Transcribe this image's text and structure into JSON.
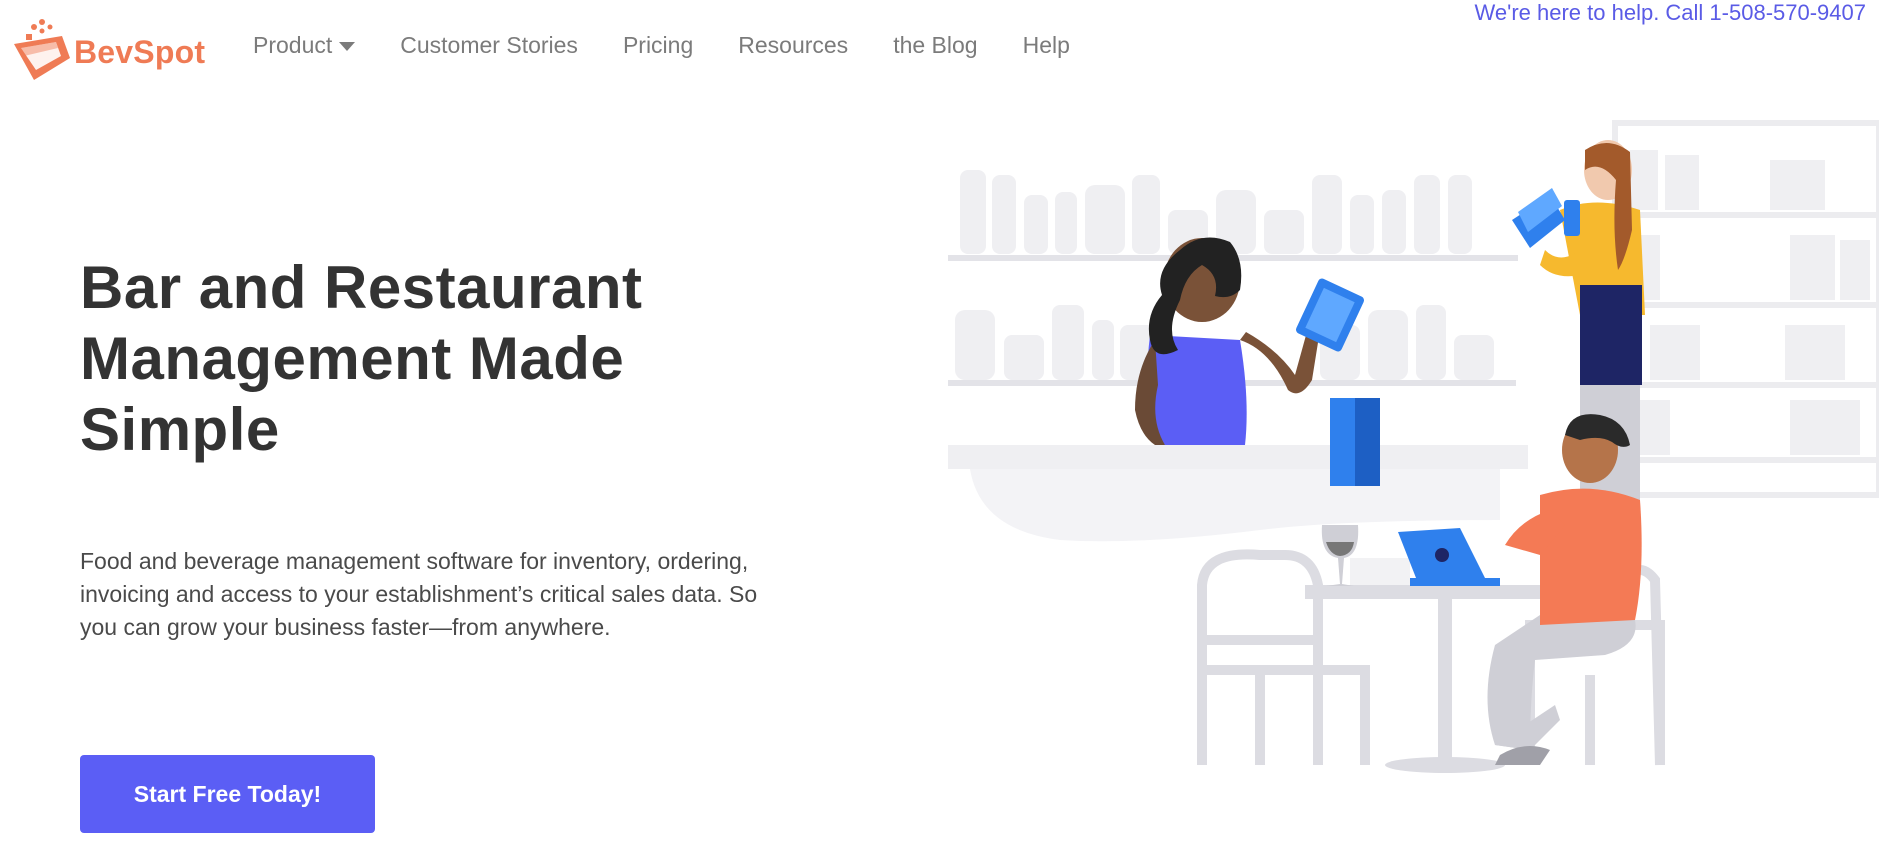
{
  "brand": {
    "name": "BevSpot",
    "logo_icon": "bevspot-logo-icon",
    "brand_color": "#ef7b55",
    "accent_color": "#5b5ef5"
  },
  "nav": {
    "product": "Product",
    "product_icon": "caret-down-icon",
    "customer_stories": "Customer Stories",
    "pricing": "Pricing",
    "resources": "Resources",
    "blog": "the Blog",
    "help": "Help"
  },
  "help_line": "We're here to help. Call 1-508-570-9407",
  "hero": {
    "title": "Bar and Restaurant Management Made Simple",
    "description": "Food and beverage management software for inventory, ordering, invoicing and access to your establishment’s critical sales data. So you can grow your business faster—from anywhere.",
    "cta_label": "Start Free Today!"
  },
  "illustration": {
    "icon": "restaurant-scene-illustration"
  }
}
